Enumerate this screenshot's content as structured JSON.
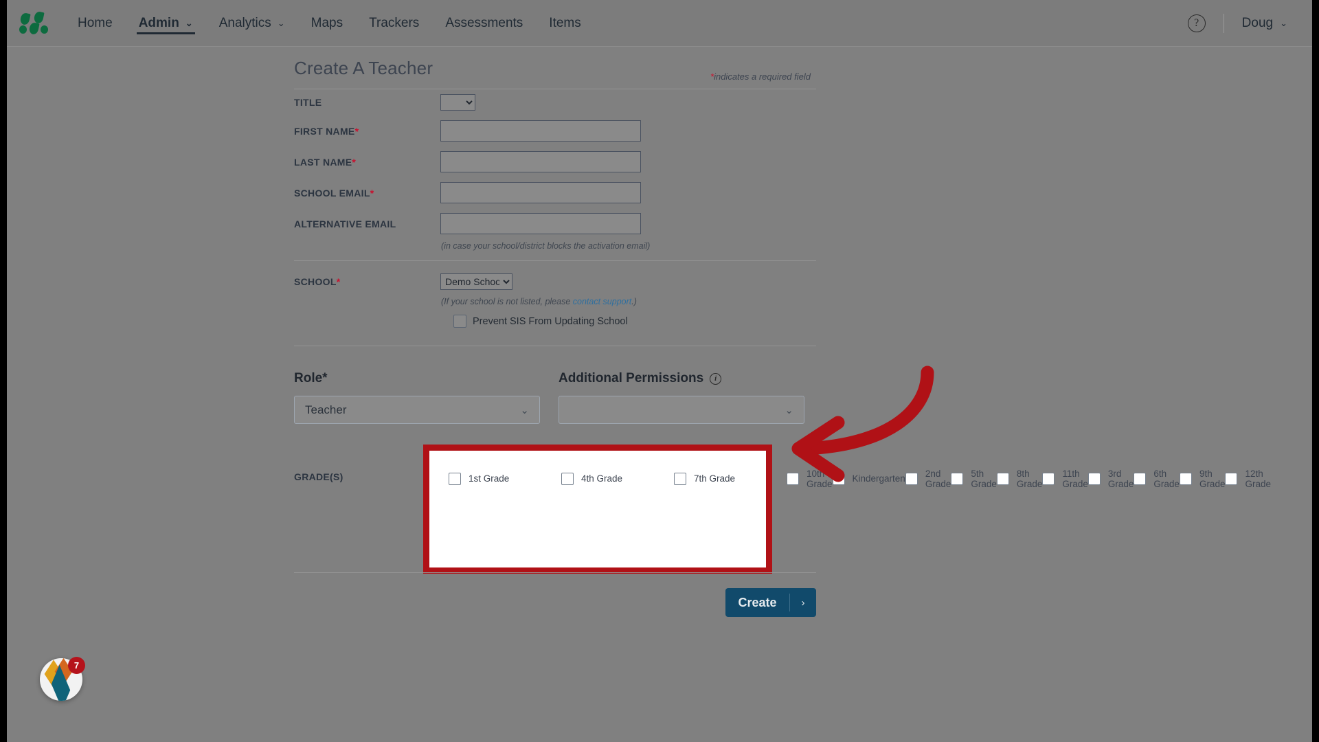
{
  "header": {
    "logo_icon": "three-seeds-logo-icon",
    "nav": [
      {
        "label": "Home",
        "has_caret": false,
        "active": false
      },
      {
        "label": "Admin",
        "has_caret": true,
        "active": true
      },
      {
        "label": "Analytics",
        "has_caret": true,
        "active": false
      },
      {
        "label": "Maps",
        "has_caret": false,
        "active": false
      },
      {
        "label": "Trackers",
        "has_caret": false,
        "active": false
      },
      {
        "label": "Assessments",
        "has_caret": false,
        "active": false
      },
      {
        "label": "Items",
        "has_caret": false,
        "active": false
      }
    ],
    "help_glyph": "?",
    "user_name": "Doug",
    "caret_glyph": "⌄"
  },
  "form": {
    "title": "Create A Teacher",
    "required_star": "*",
    "required_note": "indicates a required field",
    "fields": {
      "title": {
        "label": "TITLE",
        "required": false,
        "value": "",
        "type": "select"
      },
      "first_name": {
        "label": "FIRST NAME",
        "required": true,
        "value": "",
        "placeholder": ""
      },
      "last_name": {
        "label": "LAST NAME",
        "required": true,
        "value": "",
        "placeholder": ""
      },
      "school_email": {
        "label": "SCHOOL EMAIL",
        "required": true,
        "value": "",
        "placeholder": ""
      },
      "alternative_email": {
        "label": "ALTERNATIVE EMAIL",
        "required": false,
        "value": "",
        "placeholder": ""
      }
    },
    "alt_email_hint": "(in case your school/district blocks the activation email)",
    "school": {
      "label": "SCHOOL",
      "required": true,
      "value": "Demo School",
      "hint_prefix": "(If your school is not listed, please ",
      "hint_link": "contact support",
      "hint_suffix": ".)"
    },
    "prevent_sis": {
      "label": "Prevent SIS From Updating School",
      "checked": false
    },
    "role": {
      "label": "Role*",
      "value": "Teacher"
    },
    "permissions": {
      "label": "Additional Permissions",
      "info_glyph": "i",
      "value": ""
    },
    "grades": {
      "label": "GRADE(S)",
      "items": [
        {
          "label": "1st Grade",
          "checked": false
        },
        {
          "label": "4th Grade",
          "checked": false
        },
        {
          "label": "7th Grade",
          "checked": false
        },
        {
          "label": "10th Grade",
          "checked": false
        },
        {
          "label": "Kindergarten",
          "checked": false
        },
        {
          "label": "2nd Grade",
          "checked": false
        },
        {
          "label": "5th Grade",
          "checked": false
        },
        {
          "label": "8th Grade",
          "checked": false
        },
        {
          "label": "11th Grade",
          "checked": false
        },
        {
          "label": "3rd Grade",
          "checked": false
        },
        {
          "label": "6th Grade",
          "checked": false
        },
        {
          "label": "9th Grade",
          "checked": false
        },
        {
          "label": "12th Grade",
          "checked": false
        }
      ]
    },
    "submit": {
      "label": "Create",
      "arrow_glyph": "›"
    }
  },
  "annotation": {
    "highlight_color": "#b01116",
    "arrow_icon": "curved-left-arrow-icon"
  },
  "widget": {
    "badge_count": "7",
    "icon": "chat-launcher-icon"
  }
}
